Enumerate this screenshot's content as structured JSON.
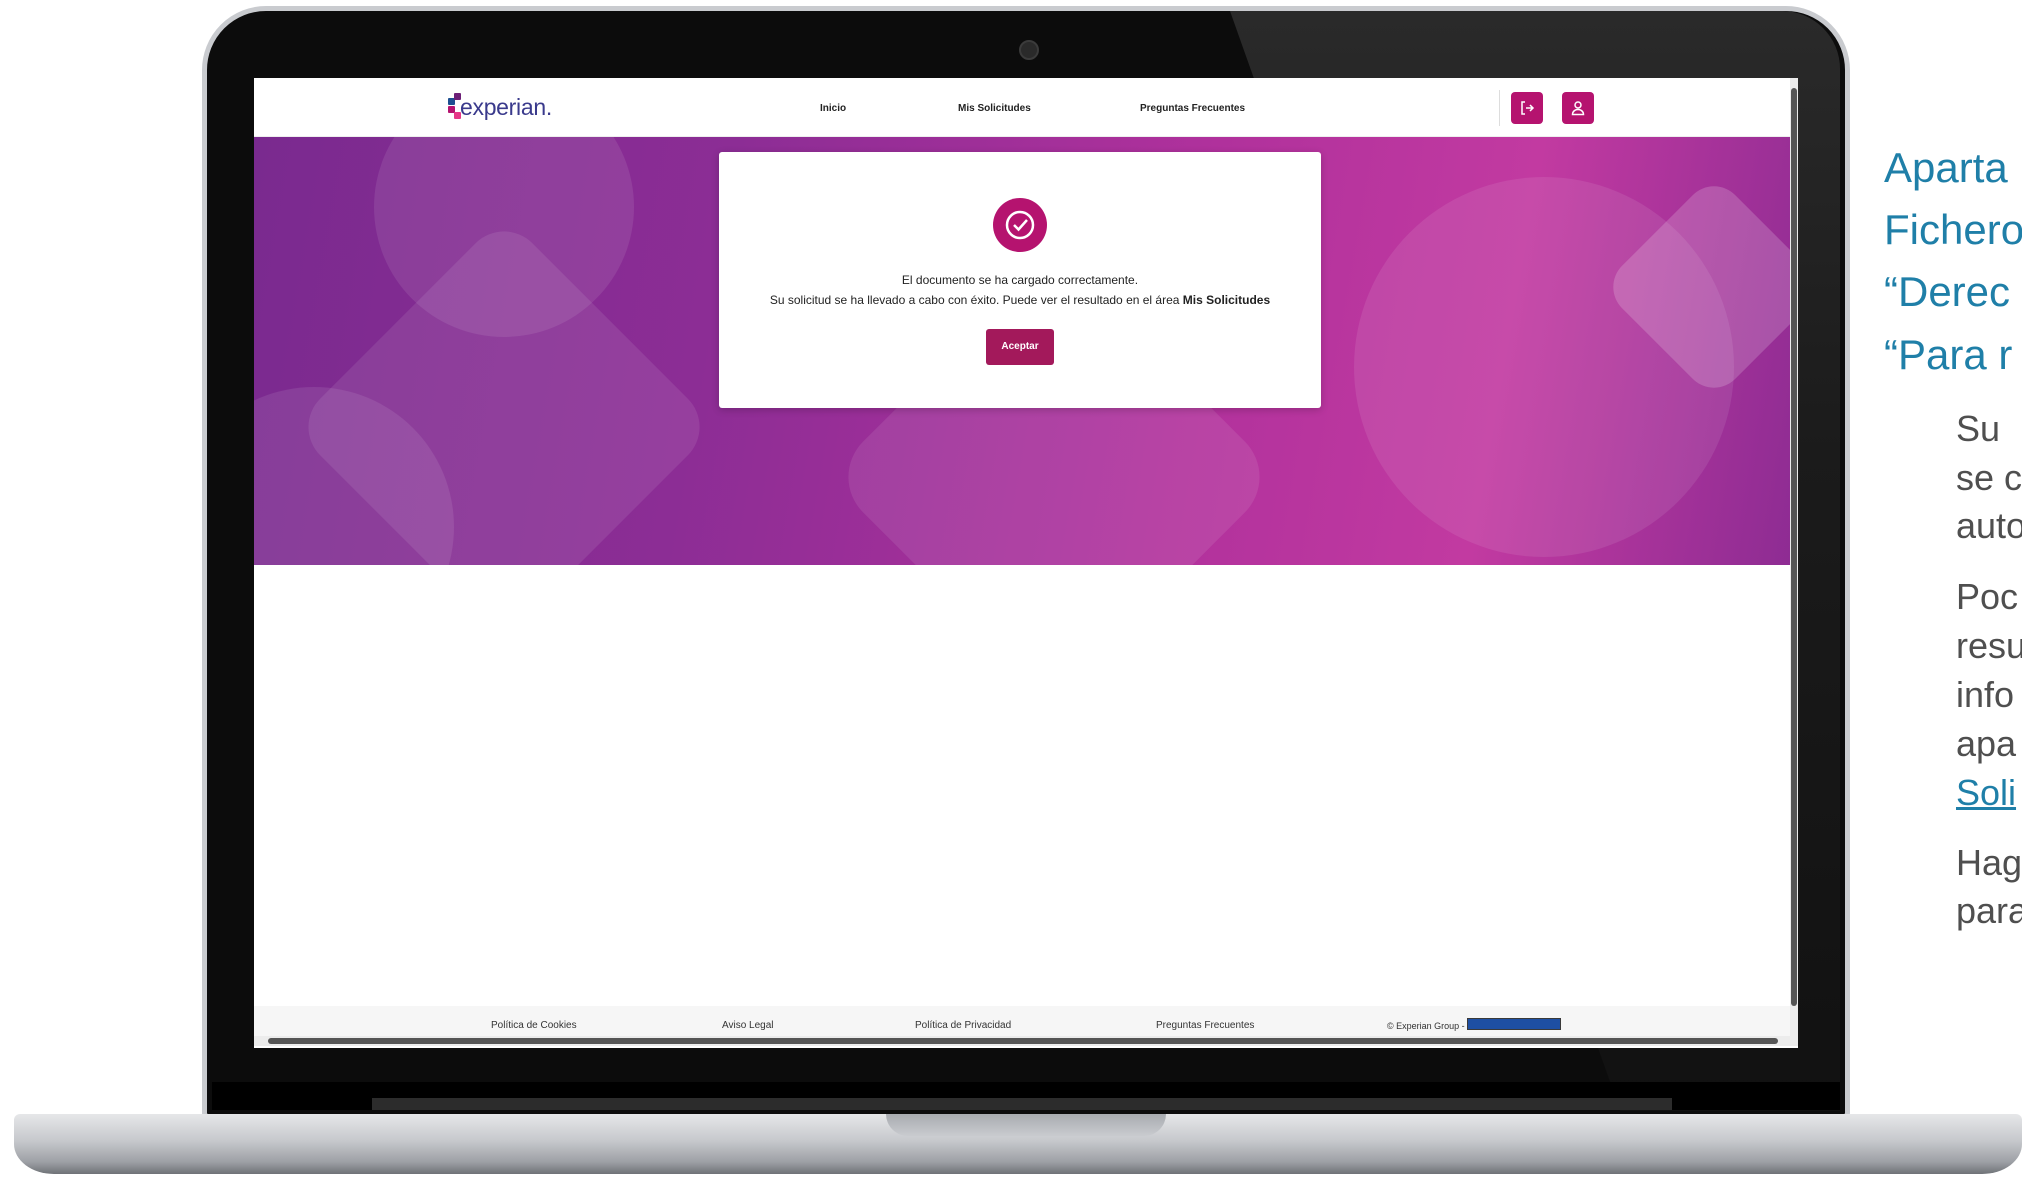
{
  "nav": {
    "logo_text": "experian.",
    "links": [
      "Inicio",
      "Mis Solicitudes",
      "Preguntas Frecuentes"
    ],
    "logout_icon": "logout-icon",
    "user_icon": "user-icon",
    "accent": "#b5136f"
  },
  "modal": {
    "icon": "check-circle-icon",
    "line1": "El documento se ha cargado correctamente.",
    "line2_prefix": "Su solicitud se ha llevado a cabo con éxito. Puede ver el resultado en el área ",
    "line2_bold": "Mis Solicitudes",
    "button": "Aceptar"
  },
  "footer": {
    "links": [
      "Política de Cookies",
      "Aviso Legal",
      "Política de Privacidad",
      "Preguntas Frecuentes"
    ],
    "copyright": "© Experian Group -"
  },
  "side_panel": {
    "heading_lines": [
      "Aparta",
      "Fichero",
      "“Derec",
      "“Para r"
    ],
    "body_lines": [
      "Su",
      "se c",
      "auto",
      "Poc",
      "resu",
      "info",
      "apa",
      "Soli",
      "Hag",
      "para"
    ],
    "link_line_index": 7,
    "heading_color": "#1f7fa8"
  }
}
